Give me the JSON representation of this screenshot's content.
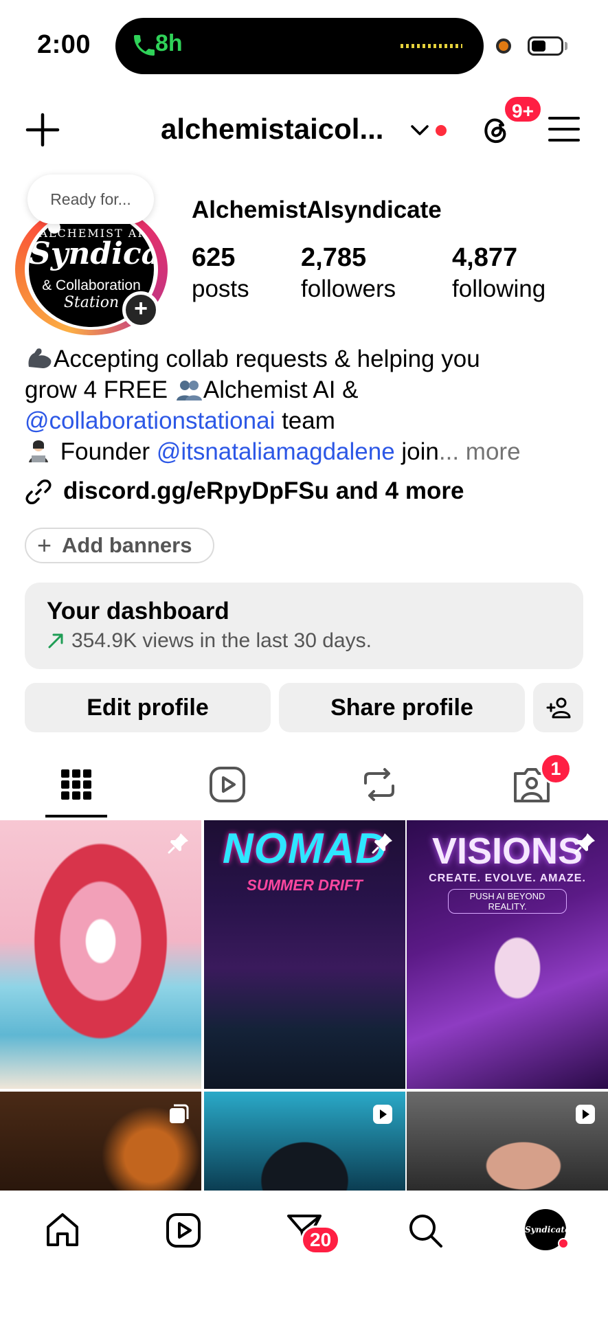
{
  "status_bar": {
    "time": "2:00",
    "call_duration": "8h"
  },
  "header": {
    "username": "alchemistaicol...",
    "threads_badge": "9+"
  },
  "profile": {
    "note": "Ready for...",
    "avatar_text": {
      "line1": "ALCHEMIST AI",
      "line2": "Syndicate",
      "line3": "& Collaboration",
      "line4": "Station"
    },
    "display_name": "AlchemistAIsyndicate",
    "stats": [
      {
        "value": "625",
        "label": "posts"
      },
      {
        "value": "2,785",
        "label": "followers"
      },
      {
        "value": "4,877",
        "label": "following"
      }
    ],
    "bio": {
      "line1_text": "Accepting collab requests & helping you",
      "line2_text": "grow 4 FREE",
      "line2_text_b": "Alchemist AI &",
      "line3_mention": "@collaborationstationai",
      "line3_text": " team",
      "line4_text": " Founder ",
      "line4_mention": "@itsnataliamagdalene",
      "line4_tail": " join",
      "line4_ellipsis": "... ",
      "line4_more": "more"
    },
    "link": "discord.gg/eRpyDpFSu and 4 more",
    "add_banners": "Add banners"
  },
  "dashboard": {
    "title": "Your dashboard",
    "subtitle": "354.9K views in the last 30 days."
  },
  "actions": {
    "edit": "Edit profile",
    "share": "Share profile"
  },
  "tabs": {
    "tagged_badge": "1"
  },
  "grid": {
    "post2": {
      "title": "NOMAD",
      "subtitle": "SUMMER DRIFT"
    },
    "post3": {
      "title": "VISIONS",
      "tagline": "CREATE. EVOLVE. AMAZE.",
      "button": "PUSH AI BEYOND REALITY."
    }
  },
  "bottom_nav": {
    "dm_badge": "20"
  },
  "colors": {
    "accent_red": "#ff1f43",
    "link_blue": "#2c57e6",
    "call_green": "#2fd158"
  }
}
